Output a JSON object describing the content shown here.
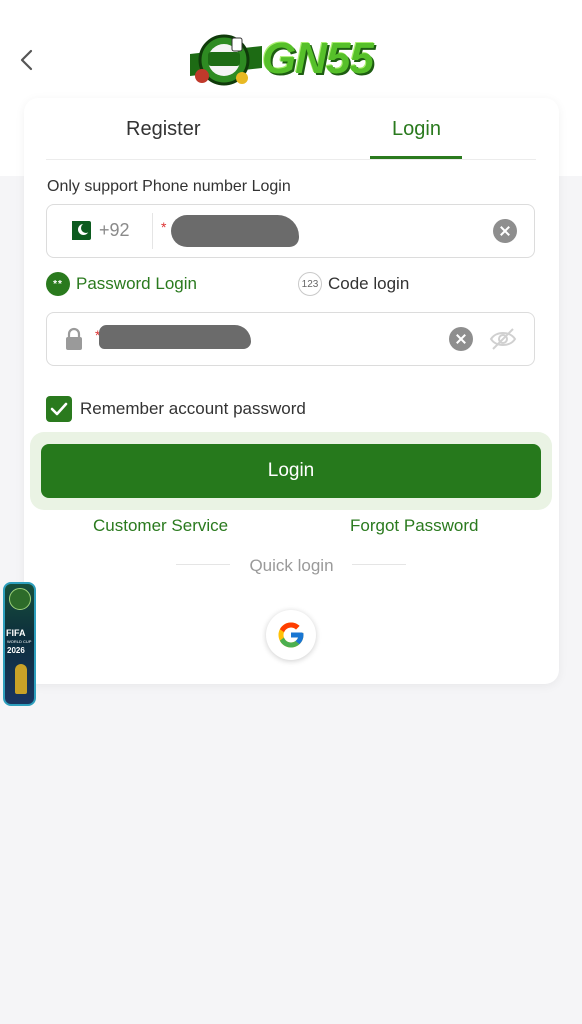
{
  "header": {
    "back_icon": "chevron-left-icon",
    "logo_text": "GN55"
  },
  "tabs": [
    {
      "label": "Register",
      "active": false
    },
    {
      "label": "Login",
      "active": true
    }
  ],
  "form": {
    "hint": "Only support Phone number Login",
    "phone": {
      "country_flag": "pakistan-flag-icon",
      "country_code": "+92",
      "required_mark": "*",
      "value": "[redacted]"
    },
    "login_modes": [
      {
        "label": "Password Login",
        "icon_text": "**",
        "active": true
      },
      {
        "label": "Code login",
        "icon_text": "123",
        "active": false
      }
    ],
    "password": {
      "required_mark": "*",
      "value": "[redacted]"
    },
    "remember": {
      "label": "Remember account password",
      "checked": true
    },
    "login_button": "Login",
    "customer_service": "Customer Service",
    "forgot_password": "Forgot Password",
    "quick_login": "Quick login"
  },
  "floating_banner": {
    "title": "FIFA",
    "subtitle": "WORLD CUP",
    "year": "2026"
  },
  "colors": {
    "accent": "#2a7a1e",
    "button": "#26791c",
    "background": "#f5f5f7"
  }
}
